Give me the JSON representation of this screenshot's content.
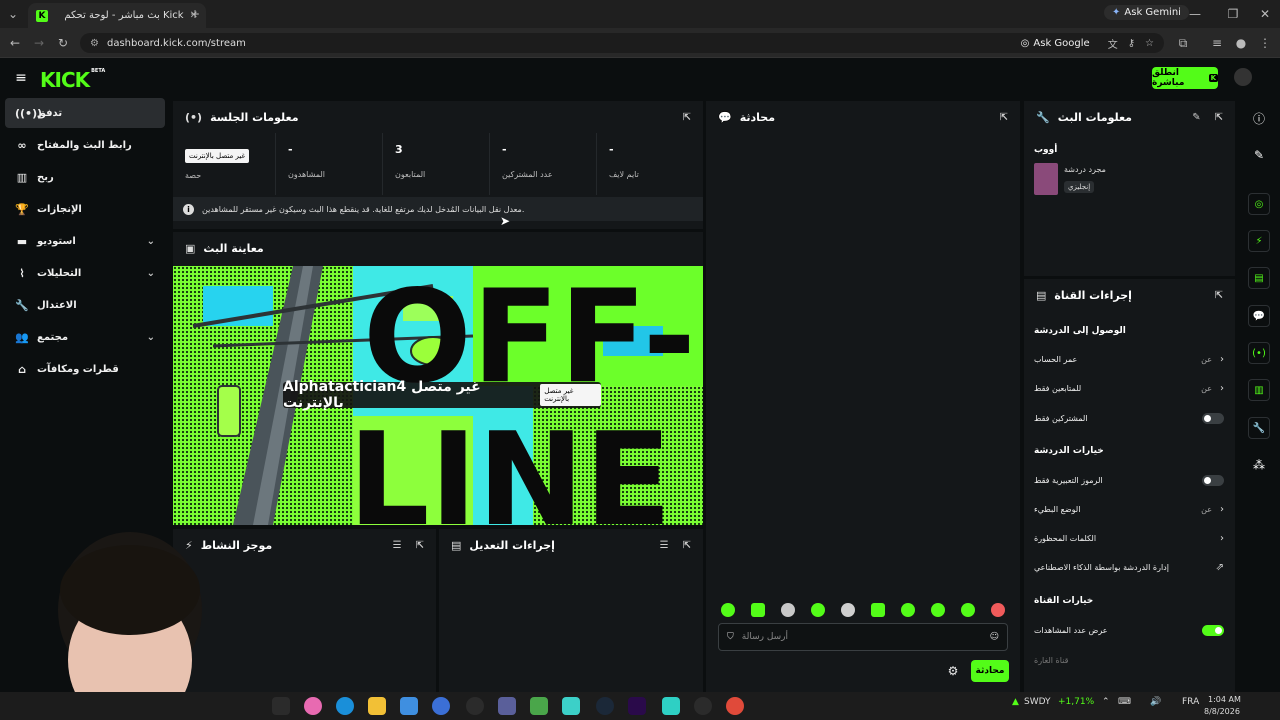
{
  "browser": {
    "tab_title": "بث مباشر - لوحة تحكم Kick",
    "url": "dashboard.kick.com/stream",
    "ask_gemini": "Ask Gemini",
    "ask_google": "Ask Google"
  },
  "header": {
    "logo": "KICK",
    "logo_badge": "BETA",
    "go_live": "انطلق مباشرة"
  },
  "sidebar": {
    "items": [
      {
        "label": "تدفق",
        "icon": "broadcast-icon"
      },
      {
        "label": "رابط البث والمفتاح",
        "icon": "link-icon"
      },
      {
        "label": "ربح",
        "icon": "chart-icon"
      },
      {
        "label": "الإنجازات",
        "icon": "trophy-icon"
      },
      {
        "label": "استوديو",
        "icon": "studio-icon"
      },
      {
        "label": "التحليلات",
        "icon": "analytics-icon"
      },
      {
        "label": "الاعتدال",
        "icon": "wrench-icon"
      },
      {
        "label": "مجتمع",
        "icon": "community-icon"
      },
      {
        "label": "قطرات ومكافآت",
        "icon": "drops-icon"
      }
    ]
  },
  "session": {
    "title": "معلومات الجلسة",
    "stats": [
      {
        "label": "تايم لايف",
        "value": "-"
      },
      {
        "label": "عدد المشتركين",
        "value": "-"
      },
      {
        "label": "المتابعون",
        "value": "3"
      },
      {
        "label": "المشاهدون",
        "value": "-"
      },
      {
        "label": "حصة",
        "value": "غير متصل بالإنترنت"
      }
    ],
    "notice": "معدل نقل البيانات المُدخل لديك مرتفع للغاية. قد ينقطع هذا البث وسيكون غير مستقر للمشاهدين."
  },
  "preview": {
    "title": "معاينة البث",
    "overlay_text": "Alphatactician4 غير متصل بالإنترنت",
    "overlay_badge": "غير متصل بالإنترنت",
    "offline_word1": "OFF-",
    "offline_word2": "LINE"
  },
  "activity": {
    "title": "موجز النشاط"
  },
  "mod_actions": {
    "title": "إجراءات التعديل"
  },
  "chat": {
    "title": "محادثة",
    "placeholder": "أرسل رسالة",
    "send_label": "محادثة"
  },
  "stream_info": {
    "title": "معلومات البث",
    "stream_name": "أووب",
    "category": "مجرد دردشة",
    "language": "إنجليزي"
  },
  "channel_actions": {
    "title": "إجراءات القناة",
    "chat_access": "الوصول إلى الدردشة",
    "account_age": "عمر الحساب",
    "account_age_value": "عن",
    "followers_only": "للمتابعين فقط",
    "followers_only_value": "عن",
    "subscribers_only": "المشتركين فقط",
    "chat_options": "خيارات الدردشة",
    "emotes_only": "الرموز التعبيرية فقط",
    "slow_mode": "الوضع البطيء",
    "slow_mode_value": "عن",
    "banned_words": "الكلمات المحظورة",
    "ai_moderation": "إدارة الدردشة بواسطة الذكاء الاصطناعي",
    "channel_options": "خيارات القناة",
    "show_viewers": "عرض عدد المشاهدات",
    "channel_ad": "قناة الغارة"
  },
  "taskbar": {
    "ticker": "SWDY",
    "ticker_change": "+1,71%",
    "lang": "FRA",
    "time": "1:04 AM",
    "date": "8/8/2026"
  },
  "colors": {
    "accent": "#53fc18",
    "panel": "#141719",
    "background": "#0b0e0f"
  }
}
